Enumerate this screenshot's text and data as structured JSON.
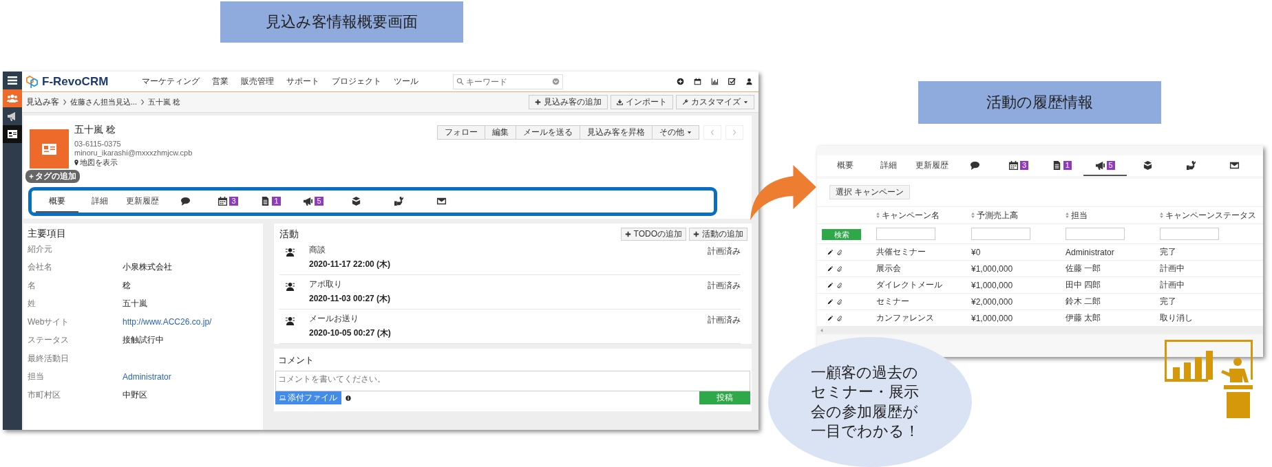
{
  "callouts": [
    {
      "text": "見込み客情報概要画面"
    },
    {
      "text": "活動の履歴情報"
    }
  ],
  "left_app": {
    "sidebar": [
      {
        "kind": "menu",
        "selected": false
      },
      {
        "kind": "leads",
        "selected": true
      },
      {
        "kind": "campaign",
        "selected": false
      },
      {
        "kind": "contact",
        "selected": false
      }
    ],
    "logo": "F-RevoCRM",
    "menu": [
      "マーケティング",
      "営業",
      "販売管理",
      "サポート",
      "プロジェクト",
      "ツール"
    ],
    "search": {
      "placeholder": "キーワード"
    },
    "breadcrumb": [
      "見込み客",
      "佐藤さん担当見込...",
      "五十嵐 稔"
    ],
    "actions": [
      {
        "label": "見込み客の追加",
        "dropdown": false
      },
      {
        "label": "インポート",
        "dropdown": false
      },
      {
        "label": "カスタマイズ",
        "dropdown": true
      }
    ],
    "record": {
      "name": "五十嵐 稔",
      "phone": "03-6115-0375",
      "email": "minoru_ikarashi@mxxxzhmjcw.cpb",
      "map_link": "地図を表示",
      "tag_button": "タグの追加"
    },
    "record_buttons": [
      {
        "label": "フォロー",
        "dropdown": false
      },
      {
        "label": "編集",
        "dropdown": false
      },
      {
        "label": "メールを送る",
        "dropdown": false
      },
      {
        "label": "見込み客を昇格",
        "dropdown": false
      },
      {
        "label": "その他",
        "dropdown": true
      }
    ],
    "tabs": [
      {
        "kind": "text",
        "label": "概要",
        "selected": true
      },
      {
        "kind": "text",
        "label": "詳細",
        "selected": false
      },
      {
        "kind": "text",
        "label": "更新履歴",
        "selected": false
      },
      {
        "kind": "comment",
        "selected": false
      },
      {
        "kind": "calendar",
        "count": "3",
        "selected": false
      },
      {
        "kind": "document",
        "count": "1",
        "selected": false
      },
      {
        "kind": "campaign",
        "count": "5",
        "selected": false
      },
      {
        "kind": "product",
        "selected": false
      },
      {
        "kind": "service",
        "selected": false
      },
      {
        "kind": "email",
        "selected": false
      }
    ],
    "key_fields": {
      "title": "主要項目",
      "rows": [
        {
          "label": "紹介元"
        },
        {
          "label": "会社名",
          "value": "小泉株式会社",
          "kind": "text"
        },
        {
          "label": "名",
          "value": "稔",
          "kind": "text"
        },
        {
          "label": "姓",
          "value": "五十嵐",
          "kind": "text"
        },
        {
          "label": "Webサイト",
          "value": "http://www.ACC26.co.jp/",
          "kind": "link"
        },
        {
          "label": "ステータス",
          "value": "接触試行中",
          "kind": "text"
        },
        {
          "label": "最終活動日"
        },
        {
          "label": "担当",
          "value": "Administrator",
          "kind": "link"
        },
        {
          "label": "市町村区",
          "value": "中野区",
          "kind": "text"
        }
      ]
    },
    "activities": {
      "title": "活動",
      "buttons": [
        "TODOの追加",
        "活動の追加"
      ],
      "items": [
        {
          "subject": "商談",
          "datetime": "2020-11-17 22:00 (木)",
          "status": "計画済み"
        },
        {
          "subject": "アポ取り",
          "datetime": "2020-11-03 00:27 (木)",
          "status": "計画済み"
        },
        {
          "subject": "メールお送り",
          "datetime": "2020-10-05 00:27 (木)",
          "status": "計画済み"
        }
      ]
    },
    "comments": {
      "title": "コメント",
      "placeholder": "コメントを書いてください。",
      "attach_button": "添付ファイル",
      "post_button": "投稿"
    }
  },
  "right_app": {
    "tabs": [
      {
        "kind": "text",
        "label": "概要",
        "selected": false
      },
      {
        "kind": "text",
        "label": "詳細",
        "selected": false
      },
      {
        "kind": "text",
        "label": "更新履歴",
        "selected": false
      },
      {
        "kind": "comment",
        "selected": false
      },
      {
        "kind": "calendar",
        "count": "3",
        "selected": false
      },
      {
        "kind": "document",
        "count": "1",
        "selected": false
      },
      {
        "kind": "campaign",
        "count": "5",
        "selected": true
      },
      {
        "kind": "product",
        "selected": false
      },
      {
        "kind": "service",
        "selected": false
      },
      {
        "kind": "email",
        "selected": false
      }
    ],
    "select_button": "選択 キャンペーン",
    "search_button": "検索",
    "columns": [
      "キャンペーン名",
      "予測売上高",
      "担当",
      "キャンペーンステータス"
    ],
    "rows": [
      {
        "name": "共催セミナー",
        "revenue": "¥0",
        "owner": "Administrator",
        "status": "完了"
      },
      {
        "name": "展示会",
        "revenue": "¥1,000,000",
        "owner": "佐藤 一郎",
        "status": "計画中"
      },
      {
        "name": "ダイレクトメール",
        "revenue": "¥1,000,000",
        "owner": "田中 四郎",
        "status": "計画中"
      },
      {
        "name": "セミナー",
        "revenue": "¥2,000,000",
        "owner": "鈴木 二郎",
        "status": "完了"
      },
      {
        "name": "カンファレンス",
        "revenue": "¥1,000,000",
        "owner": "伊藤 太郎",
        "status": "取り消し"
      }
    ]
  },
  "bubble": {
    "text": "一顧客の過去のセミナー・展示会の参加履歴が一目でわかる！"
  }
}
